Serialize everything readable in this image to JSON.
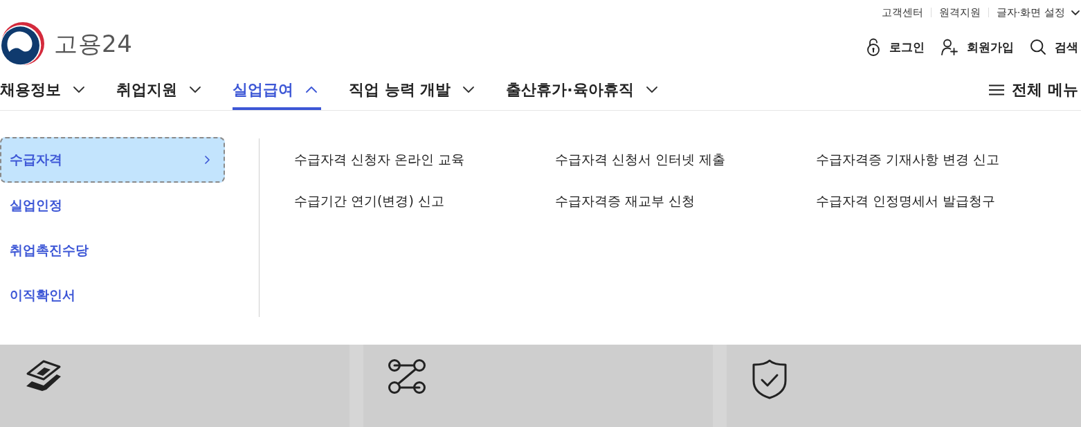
{
  "utility_links": [
    {
      "label": "고객센터",
      "kind": "link"
    },
    {
      "label": "원격지원",
      "kind": "link"
    },
    {
      "label": "글자·화면 설정",
      "kind": "dropdown"
    }
  ],
  "logo": {
    "text": "고용24"
  },
  "account_actions": [
    {
      "label": "로그인",
      "kind": "login"
    },
    {
      "label": "회원가입",
      "kind": "signup"
    },
    {
      "label": "검색",
      "kind": "search"
    }
  ],
  "main_nav": {
    "items": [
      {
        "label": "채용정보",
        "selected": false,
        "expanded": false
      },
      {
        "label": "취업지원",
        "selected": false,
        "expanded": false
      },
      {
        "label": "실업급여",
        "selected": true,
        "expanded": true
      },
      {
        "label": "직업 능력 개발",
        "selected": false,
        "expanded": false
      },
      {
        "label": "출산휴가·육아휴직",
        "selected": false,
        "expanded": false
      }
    ],
    "all_menu": {
      "label": "전체 메뉴"
    }
  },
  "submenu": {
    "categories": [
      {
        "label": "수급자격",
        "selected": true
      },
      {
        "label": "실업인정",
        "selected": false
      },
      {
        "label": "취업촉진수당",
        "selected": false
      },
      {
        "label": "이직확인서",
        "selected": false
      }
    ],
    "links": [
      "수급자격 신청자 온라인 교육",
      "수급자격 신청서 인터넷 제출",
      "수급자격증 기재사항 변경 신고",
      "수급기간 연기(변경) 신고",
      "수급자격증 재교부 신청",
      "수급자격 인정명세서 발급청구"
    ]
  },
  "service_cards": [
    {
      "kind": "stack"
    },
    {
      "kind": "network"
    },
    {
      "kind": "shield"
    }
  ]
}
